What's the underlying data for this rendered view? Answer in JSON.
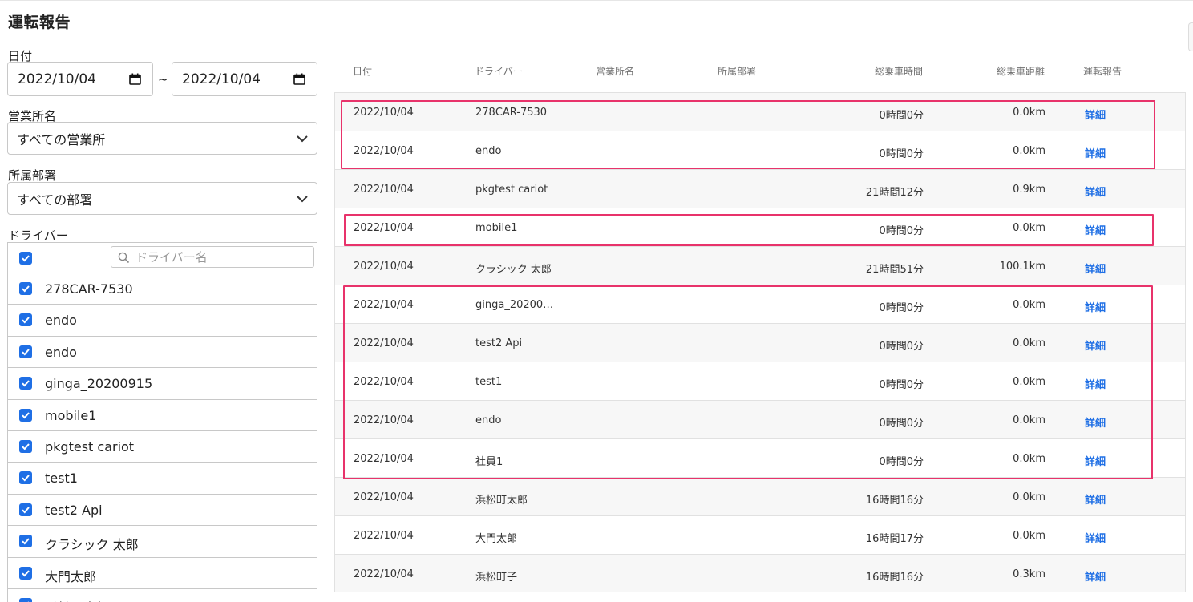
{
  "page": {
    "title": "運転報告"
  },
  "filters": {
    "date_label": "日付",
    "date_from": "2022/10/04",
    "date_to": "2022/10/04",
    "date_separator": "~",
    "office_label": "営業所名",
    "office_value": "すべての営業所",
    "department_label": "所属部署",
    "department_value": "すべての部署",
    "driver_label": "ドライバー",
    "driver_search_placeholder": "ドライバー名",
    "drivers": [
      {
        "name": "278CAR-7530",
        "checked": true
      },
      {
        "name": "endo",
        "checked": true
      },
      {
        "name": "endo",
        "checked": true
      },
      {
        "name": "ginga_20200915",
        "checked": true
      },
      {
        "name": "mobile1",
        "checked": true
      },
      {
        "name": "pkgtest cariot",
        "checked": true
      },
      {
        "name": "test1",
        "checked": true
      },
      {
        "name": "test2 Api",
        "checked": true
      },
      {
        "name": "クラシック 太郎",
        "checked": true
      },
      {
        "name": "大門太郎",
        "checked": true
      },
      {
        "name": "浜松町太郎",
        "checked": true
      }
    ]
  },
  "table": {
    "columns": {
      "date": "日付",
      "driver": "ドライバー",
      "office": "営業所名",
      "department": "所属部署",
      "total_time": "総乗車時間",
      "total_distance": "総乗車距離",
      "report": "運転報告"
    },
    "rows": [
      {
        "date": "2022/10/04",
        "driver": "278CAR-7530",
        "time": "0時間0分",
        "distance": "0.0km",
        "link": "詳細"
      },
      {
        "date": "2022/10/04",
        "driver": "endo",
        "time": "0時間0分",
        "distance": "0.0km",
        "link": "詳細"
      },
      {
        "date": "2022/10/04",
        "driver": "pkgtest cariot",
        "time": "21時間12分",
        "distance": "0.9km",
        "link": "詳細"
      },
      {
        "date": "2022/10/04",
        "driver": "mobile1",
        "time": "0時間0分",
        "distance": "0.0km",
        "link": "詳細"
      },
      {
        "date": "2022/10/04",
        "driver": "クラシック 太郎",
        "time": "21時間51分",
        "distance": "100.1km",
        "link": "詳細"
      },
      {
        "date": "2022/10/04",
        "driver": "ginga_20200…",
        "time": "0時間0分",
        "distance": "0.0km",
        "link": "詳細"
      },
      {
        "date": "2022/10/04",
        "driver": "test2 Api",
        "time": "0時間0分",
        "distance": "0.0km",
        "link": "詳細"
      },
      {
        "date": "2022/10/04",
        "driver": "test1",
        "time": "0時間0分",
        "distance": "0.0km",
        "link": "詳細"
      },
      {
        "date": "2022/10/04",
        "driver": "endo",
        "time": "0時間0分",
        "distance": "0.0km",
        "link": "詳細"
      },
      {
        "date": "2022/10/04",
        "driver": "社員1",
        "time": "0時間0分",
        "distance": "0.0km",
        "link": "詳細"
      },
      {
        "date": "2022/10/04",
        "driver": "浜松町太郎",
        "time": "16時間16分",
        "distance": "0.0km",
        "link": "詳細"
      },
      {
        "date": "2022/10/04",
        "driver": "大門太郎",
        "time": "16時間17分",
        "distance": "0.0km",
        "link": "詳細"
      },
      {
        "date": "2022/10/04",
        "driver": "浜松町子",
        "time": "16時間16分",
        "distance": "0.3km",
        "link": "詳細"
      }
    ]
  },
  "colors": {
    "accent": "#1f6fe5",
    "highlight": "#e8336b"
  }
}
